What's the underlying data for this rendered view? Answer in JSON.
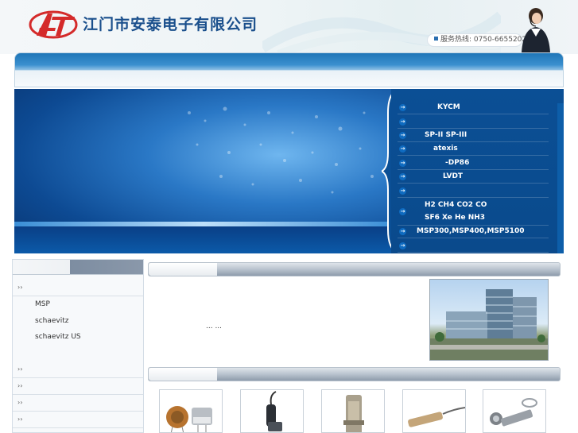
{
  "header": {
    "company_name": "江门市安泰电子有限公司",
    "logo_text": "AT",
    "hotline": "服务热线: 0750-6655202"
  },
  "categories": [
    {
      "label": "KYCM"
    },
    {
      "label": ""
    },
    {
      "label": "SP-II    SP-III"
    },
    {
      "label": "atexis"
    },
    {
      "label": "-DP86"
    },
    {
      "label": "LVDT"
    },
    {
      "label": ""
    },
    {
      "label_line1": "H2          CH4         CO2         CO",
      "label_line2": "SF6  Xe  He      NH3"
    },
    {
      "label": "MSP300,MSP400,MSP5100"
    },
    {
      "label": ""
    }
  ],
  "sidebar": {
    "submenu": [
      "MSP",
      "schaevitz",
      "schaevitz US"
    ]
  },
  "intro": {
    "text": "... ..."
  },
  "colors": {
    "brand": "#1a4f8c",
    "accent": "#d42a2a",
    "menu_bg": "#0b4f95"
  }
}
